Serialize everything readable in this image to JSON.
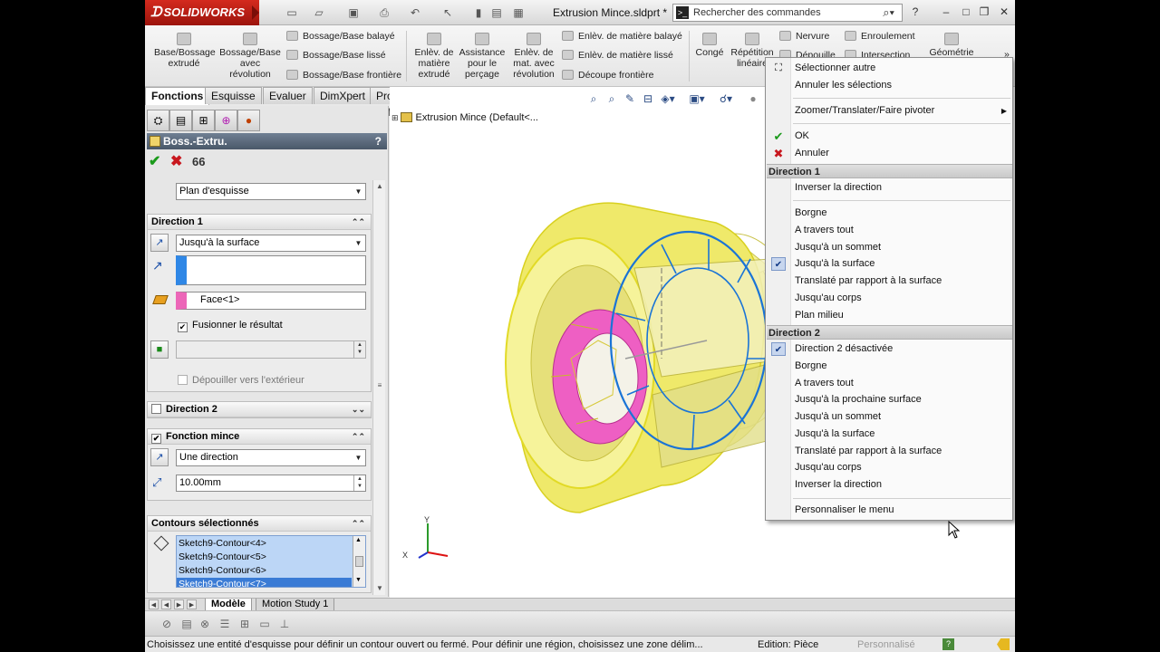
{
  "titlebar": {
    "brand": "SOLIDWORKS",
    "document_title": "Extrusion Mince.sldprt *",
    "search_placeholder": "Rechercher des commandes",
    "help_label": "?",
    "minimize": "–",
    "restore": "❐",
    "close": "✕"
  },
  "ribbon": {
    "big_buttons": [
      {
        "label": "Base/Bossage extrudé"
      },
      {
        "label": "Bossage/Base avec révolution"
      },
      {
        "label": "Enlèv. de matière extrudé"
      },
      {
        "label": "Assistance pour le perçage"
      },
      {
        "label": "Enlèv. de mat. avec révolution"
      },
      {
        "label": "Congé"
      },
      {
        "label": "Répétition linéaire"
      },
      {
        "label": "Géométrie"
      }
    ],
    "small_buttons": [
      {
        "label": "Bossage/Base balayé"
      },
      {
        "label": "Bossage/Base lissé"
      },
      {
        "label": "Bossage/Base frontière"
      },
      {
        "label": "Enlèv. de matière balayé"
      },
      {
        "label": "Enlèv. de matière lissé"
      },
      {
        "label": "Découpe frontière"
      },
      {
        "label": "Nervure"
      },
      {
        "label": "Enroulement"
      },
      {
        "label": "Dépouille"
      },
      {
        "label": "Intersection"
      }
    ],
    "expand": "»"
  },
  "tabs": [
    {
      "label": "Fonctions",
      "active": true
    },
    {
      "label": "Esquisse",
      "active": false
    },
    {
      "label": "Evaluer",
      "active": false
    },
    {
      "label": "DimXpert",
      "active": false
    },
    {
      "label": "Produits Office",
      "active": false
    }
  ],
  "property_manager": {
    "title": "Boss.-Extru.",
    "help": "?",
    "from_value": "Plan d'esquisse",
    "direction1": {
      "title": "Direction 1",
      "end_condition": "Jusqu'à la surface",
      "direction_value": "",
      "face_value": "Face<1>",
      "merge_label": "Fusionner le résultat",
      "merge_checked": true,
      "draft_value": "",
      "draft_out_label": "Dépouiller vers l'extérieur"
    },
    "direction2": {
      "title": "Direction 2"
    },
    "thin_feature": {
      "title": "Fonction mince",
      "type": "Une direction",
      "thickness": "10.00mm"
    },
    "contours": {
      "title": "Contours sélectionnés",
      "items": [
        "Sketch9-Contour<4>",
        "Sketch9-Contour<5>",
        "Sketch9-Contour<6>",
        "Sketch9-Contour<7>"
      ]
    }
  },
  "feature_tree": {
    "node_label": "Extrusion Mince  (Default<..."
  },
  "context_menu": {
    "top_items": [
      "Sélectionner autre",
      "Annuler les sélections"
    ],
    "view_item": "Zoomer/Translater/Faire pivoter",
    "ok": "OK",
    "cancel": "Annuler",
    "dir1_header": "Direction 1",
    "dir1_reverse": "Inverser la direction",
    "dir1_items": [
      "Borgne",
      "A travers tout",
      "Jusqu'à un sommet",
      "Jusqu'à la surface",
      "Translaté par rapport à la surface",
      "Jusqu'au corps",
      "Plan milieu"
    ],
    "dir1_checked_index": 3,
    "dir2_header": "Direction 2",
    "dir2_items": [
      "Direction 2 désactivée",
      "Borgne",
      "A travers tout",
      "Jusqu'à la prochaine surface",
      "Jusqu'à un sommet",
      "Jusqu'à la surface",
      "Translaté par rapport à la surface",
      "Jusqu'au corps",
      "Inverser la direction"
    ],
    "dir2_checked_index": 0,
    "customize": "Personnaliser le menu"
  },
  "model_tabs": [
    {
      "label": "Modèle",
      "active": true
    },
    {
      "label": "Motion Study 1",
      "active": false
    }
  ],
  "statusbar": {
    "message": "Choisissez une entité d'esquisse pour définir un contour ouvert ou fermé. Pour définir une région, choisissez une zone délim...",
    "edit_state": "Edition: Pièce",
    "customize": "Personnalisé"
  },
  "triad": {
    "x": "X",
    "y": "Y"
  },
  "colors": {
    "model_yellow": "#f3ee7a",
    "selection_pink": "#ee5fc3",
    "sketch_blue": "#1a74d6",
    "header_blue": "#4a5869",
    "list_highlight": "#3a7bd5"
  }
}
